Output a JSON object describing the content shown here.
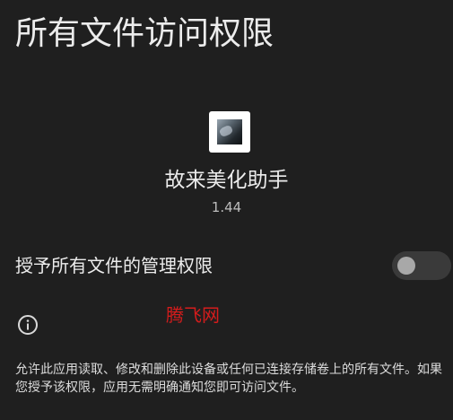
{
  "header": {
    "title": "所有文件访问权限"
  },
  "app": {
    "icon": "app-photo-icon",
    "name": "故来美化助手",
    "version": "1.44"
  },
  "permission": {
    "label": "授予所有文件的管理权限",
    "enabled": false
  },
  "info": {
    "icon": "info-icon",
    "watermark": "腾飞网",
    "description": "允许此应用读取、修改和删除此设备或任何已连接存储卷上的所有文件。如果您授予该权限，应用无需明确通知您即可访问文件。"
  },
  "colors": {
    "background": "#1f1f1f",
    "text": "#ececec",
    "watermark": "#d41c1c",
    "toggle_track": "#3a3a3a",
    "toggle_thumb": "#a8a8a8"
  }
}
